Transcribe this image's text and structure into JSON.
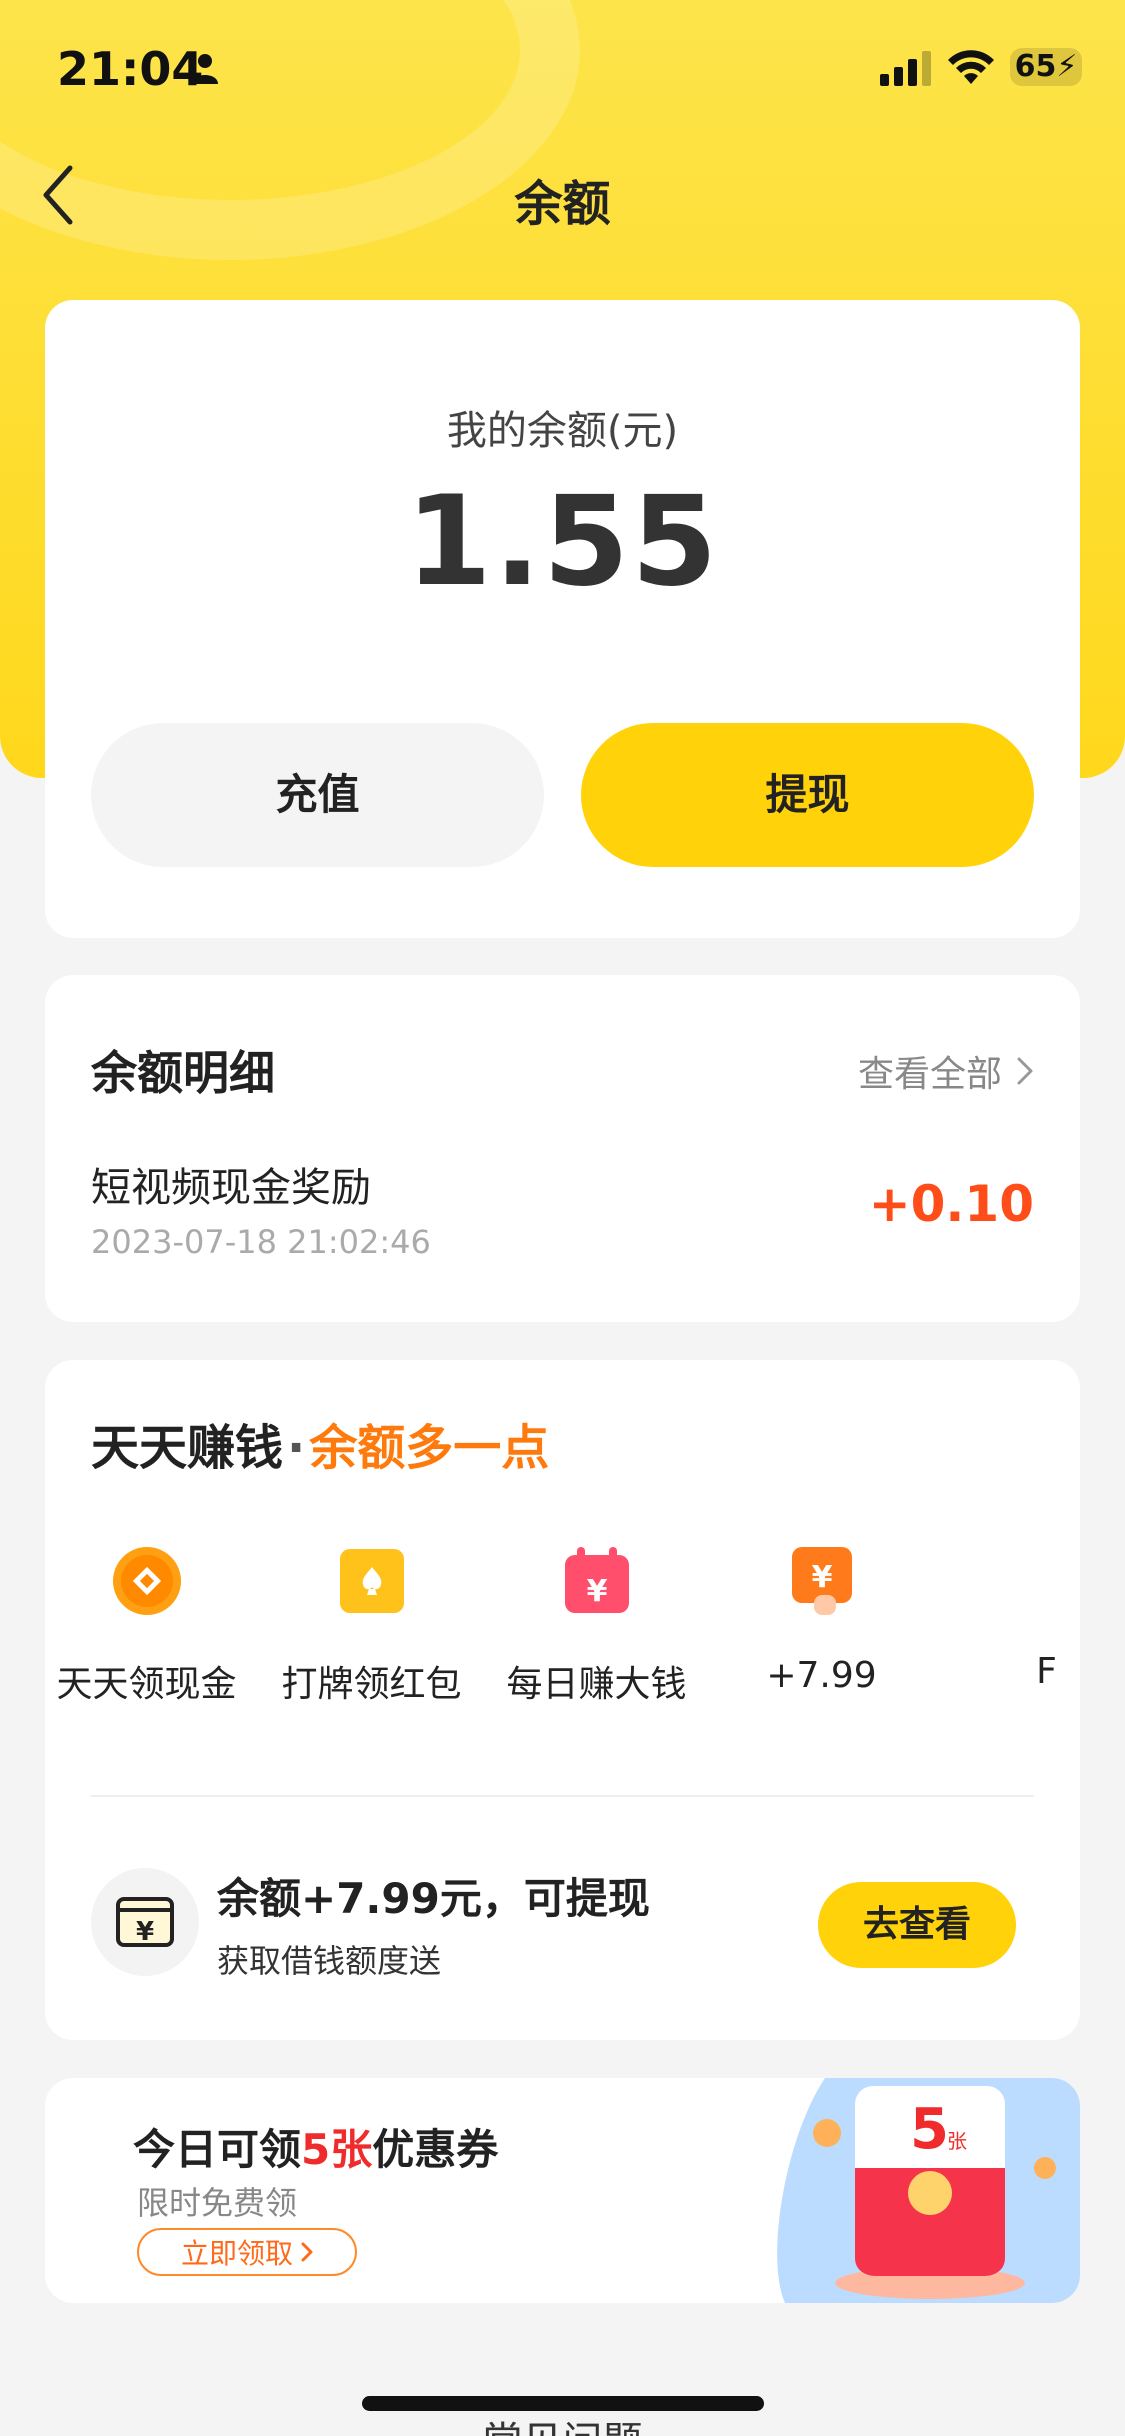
{
  "status_bar": {
    "time": "21:04",
    "battery": "65"
  },
  "nav": {
    "title": "余额",
    "back_icon": "chevron-left-icon"
  },
  "balance": {
    "label": "我的余额(元)",
    "value": "1.55",
    "recharge_label": "充值",
    "withdraw_label": "提现"
  },
  "details": {
    "title": "余额明细",
    "view_all": "查看全部",
    "transactions": [
      {
        "name": "短视频现金奖励",
        "time": "2023-07-18 21:02:46",
        "amount": "+0.10"
      }
    ]
  },
  "earn": {
    "title_main": "天天赚钱",
    "title_dot": "·",
    "title_accent": "余额多一点",
    "items": [
      {
        "label": "天天领现金",
        "icon": "coin-icon"
      },
      {
        "label": "打牌领红包",
        "icon": "playing-card-icon"
      },
      {
        "label": "每日赚大钱",
        "icon": "calendar-yuan-icon"
      },
      {
        "label": "+7.99",
        "icon": "yuan-hand-icon"
      },
      {
        "label": "F",
        "icon": "partial-icon"
      }
    ],
    "promo": {
      "title": "余额+7.99元，可提现",
      "subtitle": "获取借钱额度送",
      "button": "去查看",
      "icon": "wallet-yuan-icon"
    }
  },
  "coupon": {
    "title_pre": "今日可领",
    "title_count": "5张",
    "title_post": "优惠券",
    "subtitle": "限时免费领",
    "button": "立即领取",
    "art_count": "5",
    "art_unit": "张"
  },
  "footer": {
    "faq_peek": "常见问题"
  },
  "colors": {
    "brand_yellow": "#ffd20a",
    "accent_orange": "#ff7a0d",
    "amount_red": "#ff4d1a"
  }
}
